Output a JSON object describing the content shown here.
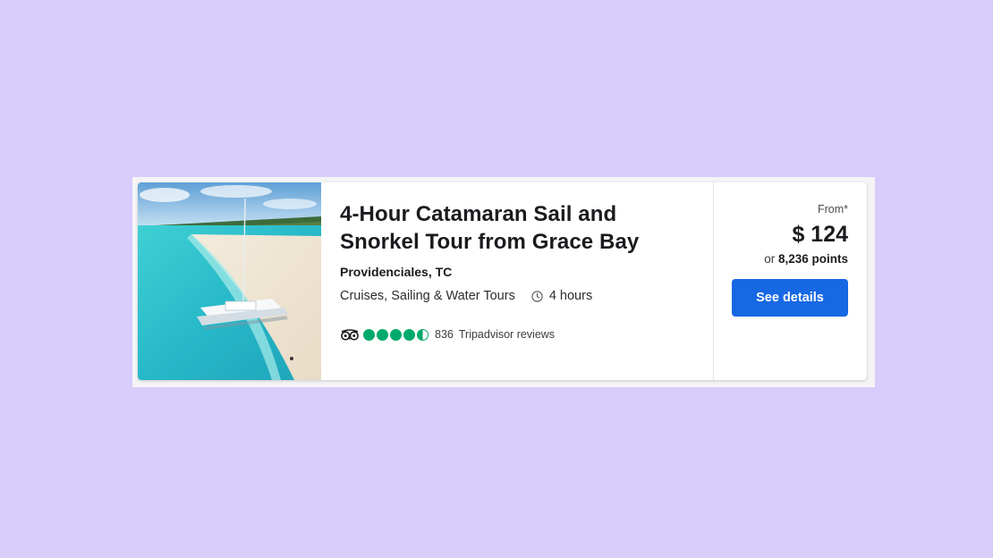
{
  "activity": {
    "title": "4-Hour Catamaran Sail and Snorkel Tour from Grace Bay",
    "location": "Providenciales, TC",
    "category": "Cruises, Sailing & Water Tours",
    "duration": "4 hours",
    "rating_bubbles": 4.5,
    "review_count": "836",
    "review_label": "Tripadvisor reviews",
    "image_alt": "Catamaran anchored in turquoise water near a sandy beach"
  },
  "pricing": {
    "from_label": "From*",
    "price": "$ 124",
    "points_prefix": "or",
    "points": "8,236 points",
    "button_label": "See details"
  },
  "colors": {
    "background": "#d8ccfb",
    "accent_button": "#1668e3",
    "rating_green": "#00aa6c"
  },
  "icons": {
    "duration": "clock-icon",
    "reviews": "tripadvisor-owl-icon"
  }
}
